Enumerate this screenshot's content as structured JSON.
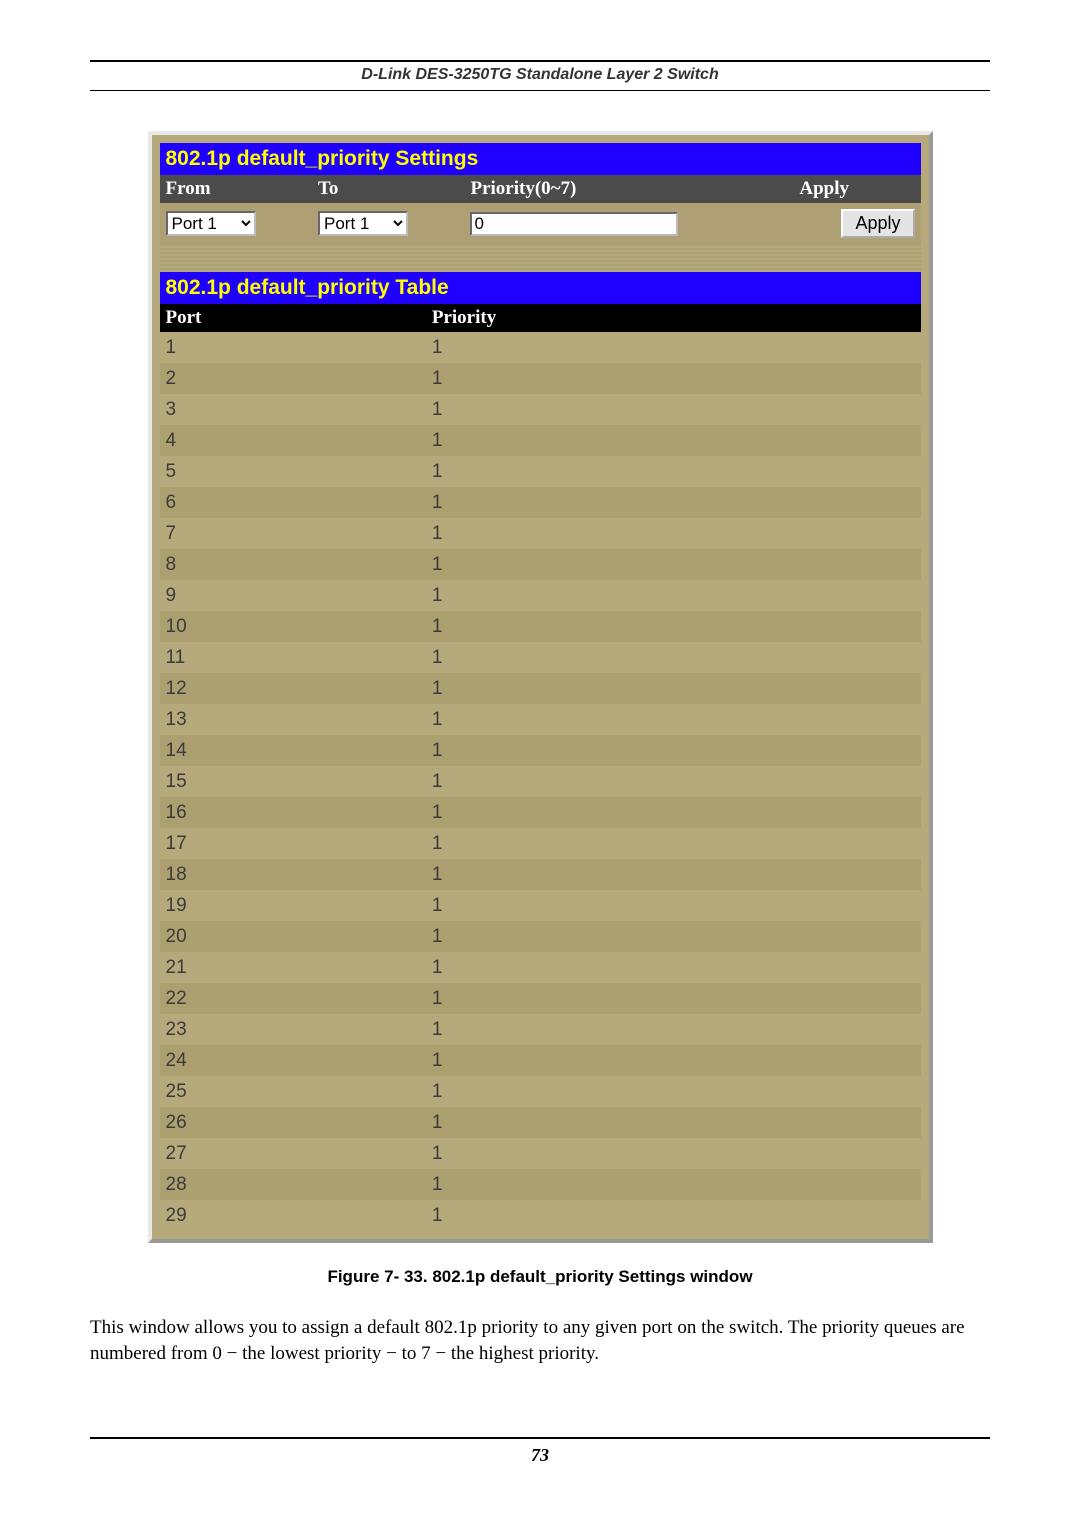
{
  "header": {
    "device": "D-Link DES-3250TG Standalone Layer 2 Switch"
  },
  "settings": {
    "title": "802.1p default_priority Settings",
    "columns": {
      "from": "From",
      "to": "To",
      "priority": "Priority(0~7)",
      "apply": "Apply"
    },
    "from_value": "Port 1",
    "to_value": "Port 1",
    "priority_value": "0",
    "apply_label": "Apply"
  },
  "table": {
    "title": "802.1p default_priority Table",
    "columns": {
      "port": "Port",
      "priority": "Priority"
    },
    "rows": [
      {
        "port": "1",
        "priority": "1"
      },
      {
        "port": "2",
        "priority": "1"
      },
      {
        "port": "3",
        "priority": "1"
      },
      {
        "port": "4",
        "priority": "1"
      },
      {
        "port": "5",
        "priority": "1"
      },
      {
        "port": "6",
        "priority": "1"
      },
      {
        "port": "7",
        "priority": "1"
      },
      {
        "port": "8",
        "priority": "1"
      },
      {
        "port": "9",
        "priority": "1"
      },
      {
        "port": "10",
        "priority": "1"
      },
      {
        "port": "11",
        "priority": "1"
      },
      {
        "port": "12",
        "priority": "1"
      },
      {
        "port": "13",
        "priority": "1"
      },
      {
        "port": "14",
        "priority": "1"
      },
      {
        "port": "15",
        "priority": "1"
      },
      {
        "port": "16",
        "priority": "1"
      },
      {
        "port": "17",
        "priority": "1"
      },
      {
        "port": "18",
        "priority": "1"
      },
      {
        "port": "19",
        "priority": "1"
      },
      {
        "port": "20",
        "priority": "1"
      },
      {
        "port": "21",
        "priority": "1"
      },
      {
        "port": "22",
        "priority": "1"
      },
      {
        "port": "23",
        "priority": "1"
      },
      {
        "port": "24",
        "priority": "1"
      },
      {
        "port": "25",
        "priority": "1"
      },
      {
        "port": "26",
        "priority": "1"
      },
      {
        "port": "27",
        "priority": "1"
      },
      {
        "port": "28",
        "priority": "1"
      },
      {
        "port": "29",
        "priority": "1"
      }
    ]
  },
  "caption": "Figure 7- 33.  802.1p default_priority Settings window",
  "body_text": "This window allows you to assign a default 802.1p priority to any given port on the switch. The priority queues are numbered from 0 − the lowest priority − to 7 − the highest priority.",
  "page_number": "73"
}
